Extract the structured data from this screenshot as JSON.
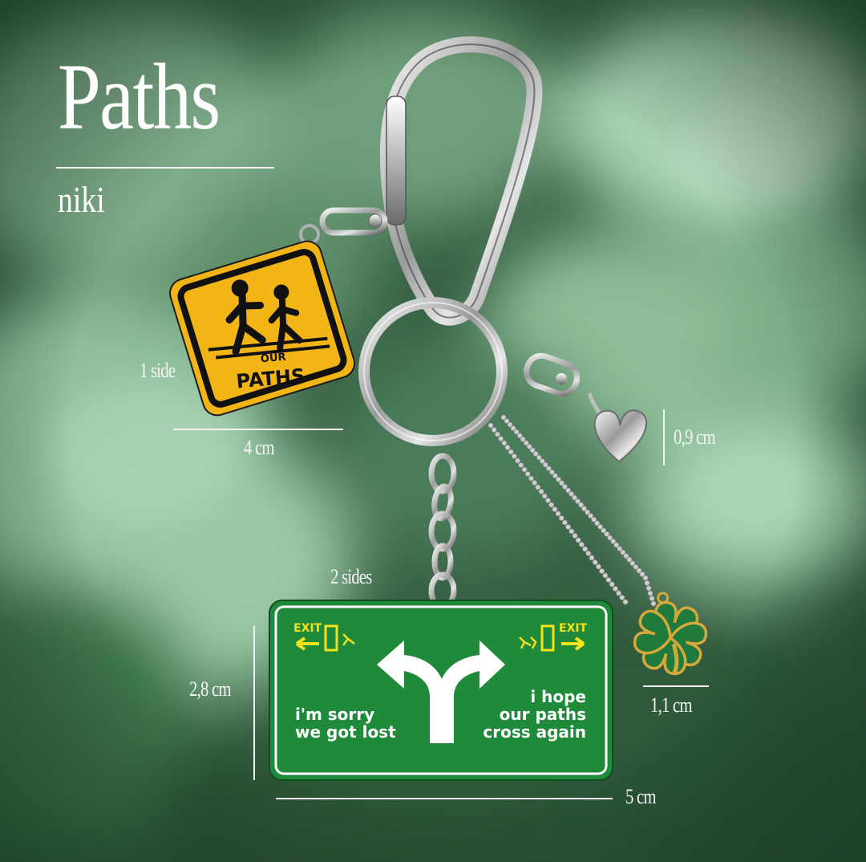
{
  "title": "Paths",
  "subtitle": "niki",
  "dimensions": {
    "charm_one_sides": "1 side",
    "charm_one_width": "4 cm",
    "heart_height": "0,9 cm",
    "sign_sides": "2 sides",
    "sign_height": "2,8 cm",
    "sign_width": "5 cm",
    "clover_width": "1,1 cm"
  },
  "yellow_sign": {
    "small_text": "OUR",
    "big_text": "PATHS"
  },
  "green_sign": {
    "exit_left": "EXIT",
    "exit_right": "EXIT",
    "left_line1": "i'm sorry",
    "left_line2": "we got lost",
    "right_line1": "i hope",
    "right_line2": "our paths",
    "right_line3": "cross again"
  },
  "colors": {
    "sign_green": "#1f8a3a",
    "sign_yellow": "#f2b515",
    "background_green": "#3f6f4c"
  }
}
